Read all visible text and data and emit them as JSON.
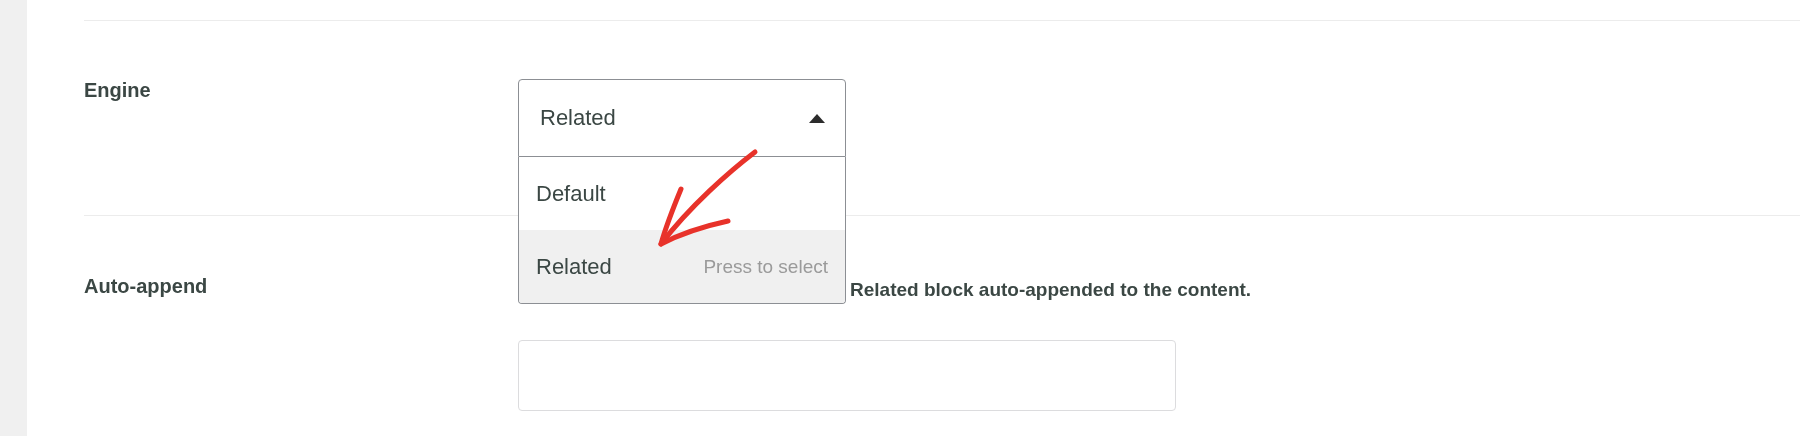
{
  "sections": [
    {
      "label": "Engine",
      "kind": "select",
      "select": {
        "value": "Related",
        "expanded": true,
        "options": [
          {
            "label": "Default",
            "selected": false
          },
          {
            "label": "Related",
            "selected": true,
            "hint": "Press to select"
          }
        ]
      }
    },
    {
      "label": "Auto-append",
      "kind": "text-input",
      "description": "Related block auto-appended to the content."
    }
  ]
}
